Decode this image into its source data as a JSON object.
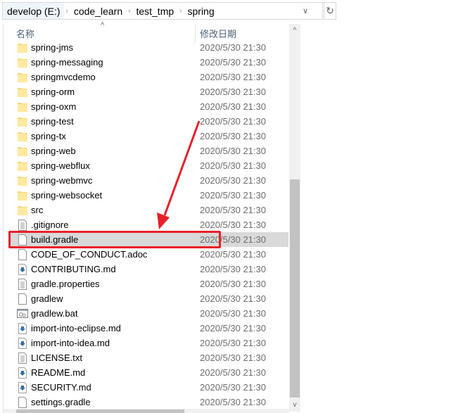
{
  "address": {
    "crumbs": [
      "develop (E:)",
      "code_learn",
      "test_tmp",
      "spring"
    ]
  },
  "columns": {
    "name": "名称",
    "date": "修改日期"
  },
  "colors": {
    "highlight": "#e8202a",
    "selected_row": "#d9d9d9"
  },
  "files": [
    {
      "name": "spring-jms",
      "date": "2020/5/30 21:30",
      "icon": "folder"
    },
    {
      "name": "spring-messaging",
      "date": "2020/5/30 21:30",
      "icon": "folder"
    },
    {
      "name": "springmvcdemo",
      "date": "2020/5/30 21:30",
      "icon": "folder"
    },
    {
      "name": "spring-orm",
      "date": "2020/5/30 21:30",
      "icon": "folder"
    },
    {
      "name": "spring-oxm",
      "date": "2020/5/30 21:30",
      "icon": "folder"
    },
    {
      "name": "spring-test",
      "date": "2020/5/30 21:30",
      "icon": "folder"
    },
    {
      "name": "spring-tx",
      "date": "2020/5/30 21:30",
      "icon": "folder"
    },
    {
      "name": "spring-web",
      "date": "2020/5/30 21:30",
      "icon": "folder"
    },
    {
      "name": "spring-webflux",
      "date": "2020/5/30 21:30",
      "icon": "folder"
    },
    {
      "name": "spring-webmvc",
      "date": "2020/5/30 21:30",
      "icon": "folder"
    },
    {
      "name": "spring-websocket",
      "date": "2020/5/30 21:30",
      "icon": "folder"
    },
    {
      "name": "src",
      "date": "2020/5/30 21:30",
      "icon": "folder"
    },
    {
      "name": ".gitignore",
      "date": "2020/5/30 21:30",
      "icon": "text"
    },
    {
      "name": "build.gradle",
      "date": "2020/5/30 21:30",
      "icon": "blank",
      "selected": true
    },
    {
      "name": "CODE_OF_CONDUCT.adoc",
      "date": "2020/5/30 21:30",
      "icon": "blank"
    },
    {
      "name": "CONTRIBUTING.md",
      "date": "2020/5/30 21:30",
      "icon": "md"
    },
    {
      "name": "gradle.properties",
      "date": "2020/5/30 21:30",
      "icon": "text"
    },
    {
      "name": "gradlew",
      "date": "2020/5/30 21:30",
      "icon": "blank"
    },
    {
      "name": "gradlew.bat",
      "date": "2020/5/30 21:30",
      "icon": "bat"
    },
    {
      "name": "import-into-eclipse.md",
      "date": "2020/5/30 21:30",
      "icon": "md"
    },
    {
      "name": "import-into-idea.md",
      "date": "2020/5/30 21:30",
      "icon": "md"
    },
    {
      "name": "LICENSE.txt",
      "date": "2020/5/30 21:30",
      "icon": "text"
    },
    {
      "name": "README.md",
      "date": "2020/5/30 21:30",
      "icon": "md"
    },
    {
      "name": "SECURITY.md",
      "date": "2020/5/30 21:30",
      "icon": "md"
    },
    {
      "name": "settings.gradle",
      "date": "2020/5/30 21:30",
      "icon": "blank"
    }
  ]
}
